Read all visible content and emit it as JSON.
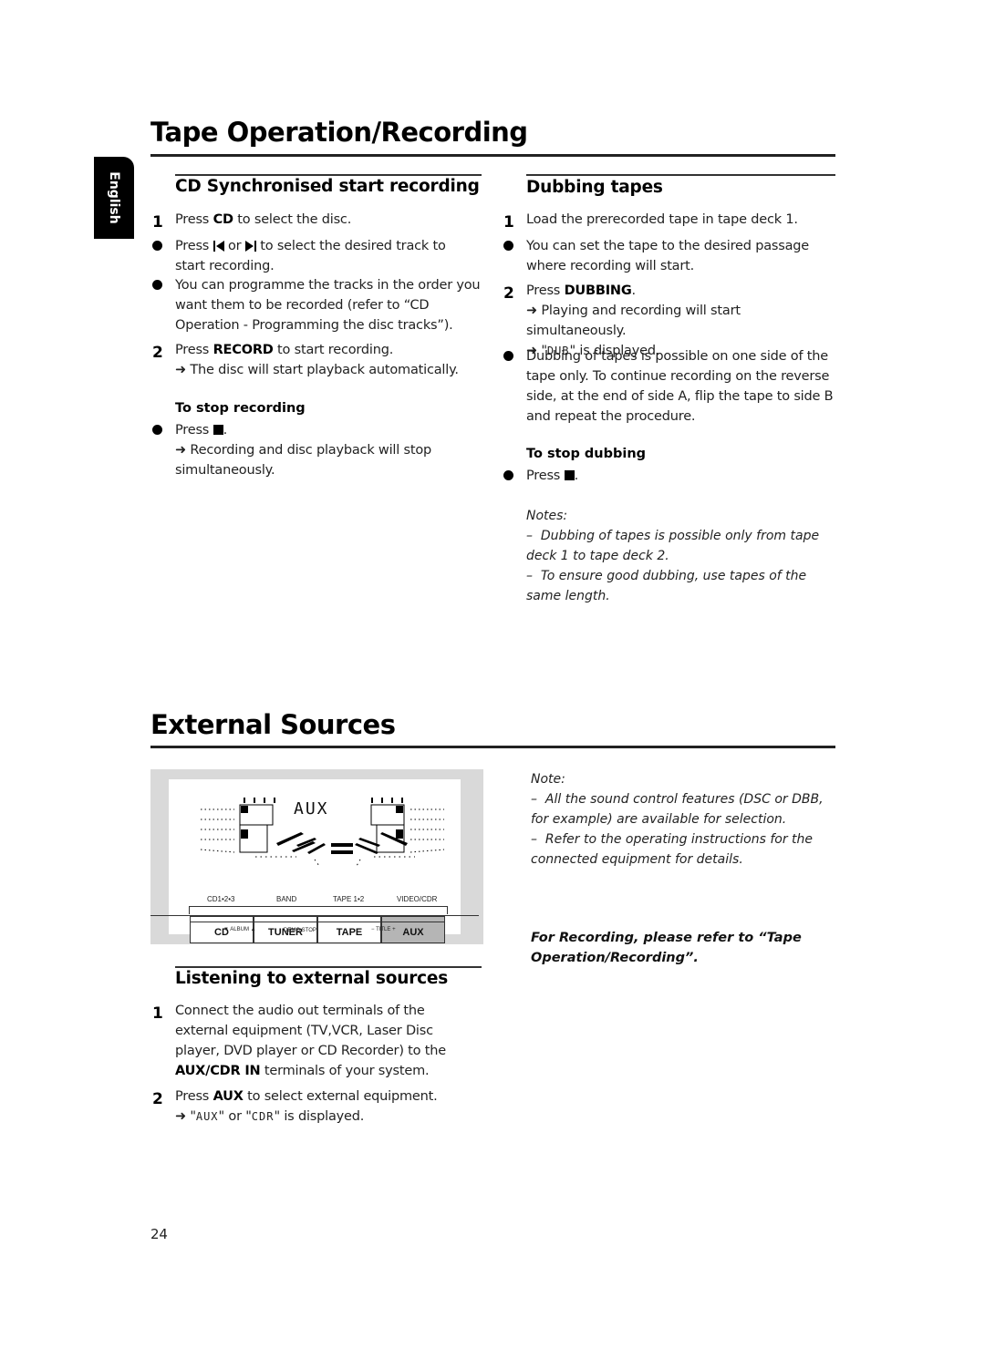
{
  "page": {
    "number": "24",
    "language_tab": "English"
  },
  "tape_section": {
    "title": "Tape Operation/Recording",
    "cd_sync": {
      "heading": "CD Synchronised start recording",
      "step1": {
        "num": "1",
        "pre": "Press ",
        "bold": "CD",
        "post": " to select the disc."
      },
      "bullet1": {
        "pre": "Press ",
        "mid": " or ",
        "post": " to select the desired track to start recording.",
        "icon_prev": "skip-previous-icon",
        "icon_next": "skip-next-icon"
      },
      "bullet2": "You can programme the tracks in the order you want them to be recorded (refer to “CD Operation - Programming the disc tracks”).",
      "step2": {
        "num": "2",
        "pre": "Press ",
        "bold": "RECORD",
        "post": " to start recording.",
        "result": "The disc will start playback automatically."
      },
      "stop": {
        "heading": "To stop recording",
        "press": "Press",
        "icon": "stop-icon",
        "result": "Recording and disc playback will stop simultaneously."
      }
    },
    "dubbing": {
      "heading": "Dubbing tapes",
      "step1": {
        "num": "1",
        "text": "Load the prerecorded tape in tape deck 1."
      },
      "bullet1": "You can set the tape to the desired passage where recording will start.",
      "step2": {
        "num": "2",
        "pre": "Press ",
        "bold": "DUBBING",
        "post": ".",
        "result1": "Playing and recording will start simultaneously.",
        "result2_lcd": "DUB",
        "result2_post": " is displayed."
      },
      "bullet2": "Dubbing of tapes is possible on one side of the tape only. To continue recording on the reverse side, at the end of side A, flip the tape to side B and repeat the procedure.",
      "stop": {
        "heading": "To stop dubbing",
        "press": "Press",
        "icon": "stop-icon"
      },
      "notes_title": "Notes:",
      "notes": [
        "Dubbing of tapes is possible only from tape deck 1 to tape deck 2.",
        "To ensure good dubbing, use tapes of the same length."
      ]
    }
  },
  "external_section": {
    "title": "External Sources",
    "figure": {
      "display_text": "AUX",
      "source_labels": [
        "CD1•2•3",
        "BAND",
        "TAPE 1•2",
        "VIDEO/CDR"
      ],
      "buttons": [
        {
          "label": "CD",
          "active": false
        },
        {
          "label": "TUNER",
          "active": false
        },
        {
          "label": "TAPE",
          "active": false
        },
        {
          "label": "AUX",
          "active": true
        }
      ],
      "sub_labels": {
        "album": "▼ ALBUM ▲",
        "demo": "DEMO STOP",
        "title": "−  TITLE  +"
      }
    },
    "listening": {
      "heading": "Listening to external sources",
      "step1": {
        "num": "1",
        "pre": "Connect the audio out terminals of the external equipment (TV,VCR, Laser Disc player, DVD player or CD Recorder) to the ",
        "bold": "AUX/CDR IN",
        "post": " terminals of your system."
      },
      "step2": {
        "num": "2",
        "pre": "Press ",
        "bold": "AUX",
        "post": " to select external equipment.",
        "result_lcd1": "AUX",
        "result_mid": " or ",
        "result_lcd2": "CDR",
        "result_post": " is displayed."
      }
    },
    "note_title": "Note:",
    "notes": [
      "All the sound control features (DSC or DBB, for example) are available for selection.",
      "Refer to the operating instructions for the connected equipment for details."
    ],
    "recording_ref": "For Recording, please refer to “Tape Operation/Recording”."
  },
  "colors": {
    "text": "#111111",
    "figure_bg": "#d9d9d9",
    "active_button": "#b5b5b5",
    "lang_tab": "#000000"
  }
}
